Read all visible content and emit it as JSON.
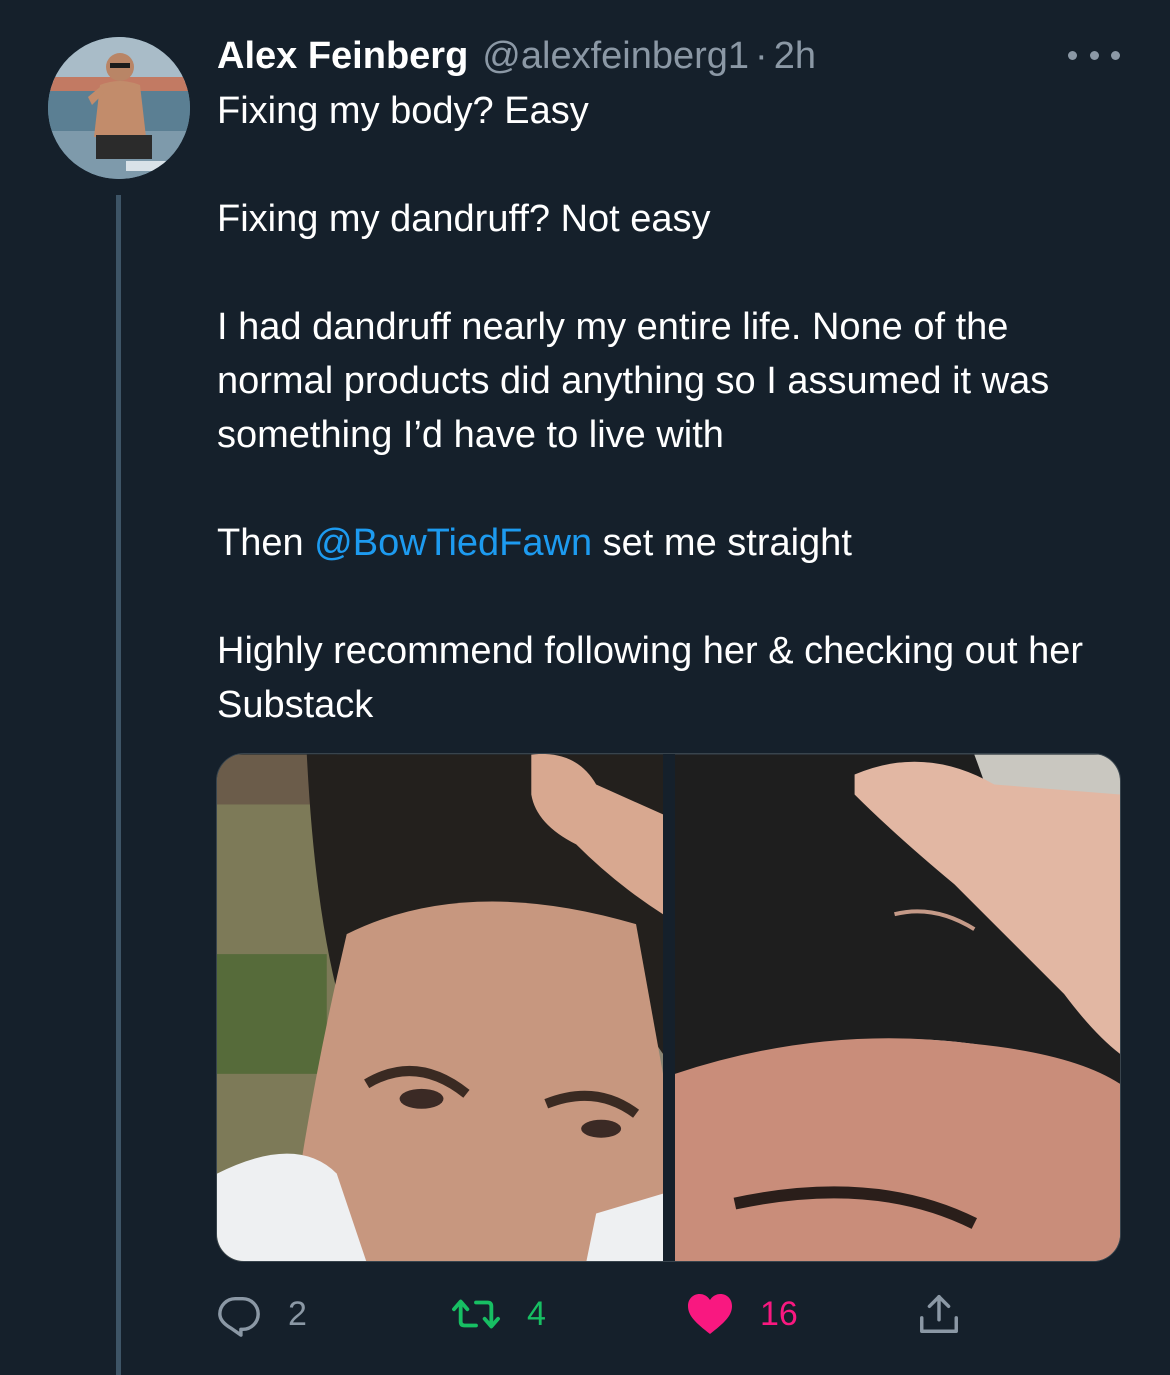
{
  "tweet": {
    "author_name": "Alex Feinberg",
    "author_handle": "@alexfeinberg1",
    "separator": "·",
    "timestamp": "2h",
    "text": {
      "line1": "Fixing my body? Easy",
      "line2": "Fixing my dandruff? Not easy",
      "line3": "I had dandruff nearly my entire life. None of the normal products did anything so I assumed it was something I’d have to live with",
      "line4_prefix": "Then ",
      "line4_mention": "@BowTiedFawn",
      "line4_suffix": " set me straight",
      "line5": "Highly recommend following her & checking out her Substack"
    }
  },
  "actions": {
    "reply_count": "2",
    "retweet_count": "4",
    "like_count": "16"
  },
  "icons": {
    "more": "more-options-icon",
    "reply": "reply-icon",
    "retweet": "retweet-icon",
    "like": "heart-icon",
    "share": "share-icon"
  },
  "colors": {
    "background": "#15202b",
    "secondary_text": "#8b98a5",
    "mention": "#1d9bf0",
    "retweet_active": "#17bf63",
    "like_active": "#f91880"
  }
}
